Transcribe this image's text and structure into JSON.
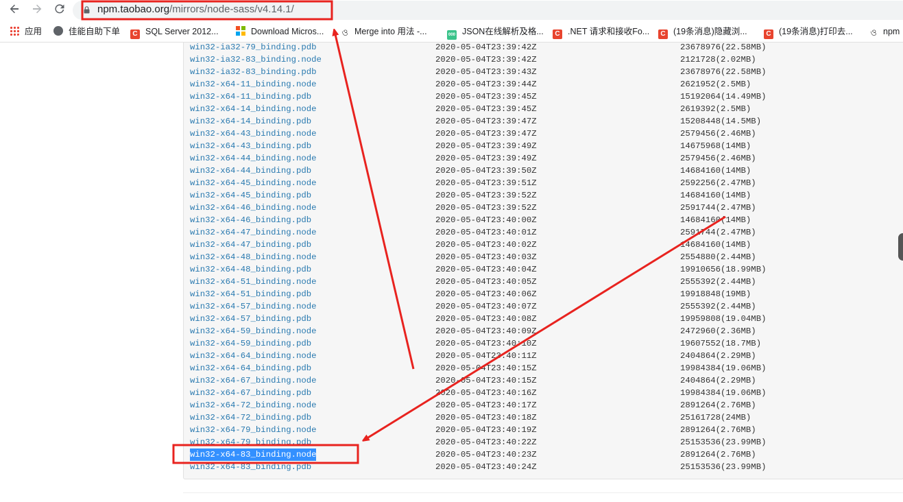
{
  "browser": {
    "back_icon": "back-arrow-icon",
    "forward_icon": "forward-arrow-icon",
    "reload_icon": "reload-icon",
    "url_host": "npm.taobao.org",
    "url_path": "/mirrors/node-sass/v4.14.1/"
  },
  "bookmarks": [
    {
      "label": "应用",
      "icon": "apps-grid-icon"
    },
    {
      "label": "佳能自助下单",
      "icon": "globe-icon"
    },
    {
      "label": "SQL Server 2012...",
      "icon": "csdn-icon"
    },
    {
      "label": "Download Micros...",
      "icon": "microsoft-icon"
    },
    {
      "label": "Merge into 用法 -...",
      "icon": "curl-icon"
    },
    {
      "label": "JSON在线解析及格...",
      "icon": "json-icon"
    },
    {
      "label": ".NET 请求和接收Fo...",
      "icon": "csdn-icon"
    },
    {
      "label": "(19条消息)隐藏浏...",
      "icon": "csdn-icon"
    },
    {
      "label": "(19条消息)打印去...",
      "icon": "csdn-icon"
    },
    {
      "label": "npm",
      "icon": "curl-icon"
    }
  ],
  "files": [
    {
      "name": "win32-ia32-79_binding.pdb",
      "date": "2020-05-04T23:39:42Z",
      "size": "23678976(22.58MB)"
    },
    {
      "name": "win32-ia32-83_binding.node",
      "date": "2020-05-04T23:39:42Z",
      "size": "2121728(2.02MB)"
    },
    {
      "name": "win32-ia32-83_binding.pdb",
      "date": "2020-05-04T23:39:43Z",
      "size": "23678976(22.58MB)"
    },
    {
      "name": "win32-x64-11_binding.node",
      "date": "2020-05-04T23:39:44Z",
      "size": "2621952(2.5MB)"
    },
    {
      "name": "win32-x64-11_binding.pdb",
      "date": "2020-05-04T23:39:45Z",
      "size": "15192064(14.49MB)"
    },
    {
      "name": "win32-x64-14_binding.node",
      "date": "2020-05-04T23:39:45Z",
      "size": "2619392(2.5MB)"
    },
    {
      "name": "win32-x64-14_binding.pdb",
      "date": "2020-05-04T23:39:47Z",
      "size": "15208448(14.5MB)"
    },
    {
      "name": "win32-x64-43_binding.node",
      "date": "2020-05-04T23:39:47Z",
      "size": "2579456(2.46MB)"
    },
    {
      "name": "win32-x64-43_binding.pdb",
      "date": "2020-05-04T23:39:49Z",
      "size": "14675968(14MB)"
    },
    {
      "name": "win32-x64-44_binding.node",
      "date": "2020-05-04T23:39:49Z",
      "size": "2579456(2.46MB)"
    },
    {
      "name": "win32-x64-44_binding.pdb",
      "date": "2020-05-04T23:39:50Z",
      "size": "14684160(14MB)"
    },
    {
      "name": "win32-x64-45_binding.node",
      "date": "2020-05-04T23:39:51Z",
      "size": "2592256(2.47MB)"
    },
    {
      "name": "win32-x64-45_binding.pdb",
      "date": "2020-05-04T23:39:52Z",
      "size": "14684160(14MB)"
    },
    {
      "name": "win32-x64-46_binding.node",
      "date": "2020-05-04T23:39:52Z",
      "size": "2591744(2.47MB)"
    },
    {
      "name": "win32-x64-46_binding.pdb",
      "date": "2020-05-04T23:40:00Z",
      "size": "14684160(14MB)"
    },
    {
      "name": "win32-x64-47_binding.node",
      "date": "2020-05-04T23:40:01Z",
      "size": "2591744(2.47MB)"
    },
    {
      "name": "win32-x64-47_binding.pdb",
      "date": "2020-05-04T23:40:02Z",
      "size": "14684160(14MB)"
    },
    {
      "name": "win32-x64-48_binding.node",
      "date": "2020-05-04T23:40:03Z",
      "size": "2554880(2.44MB)"
    },
    {
      "name": "win32-x64-48_binding.pdb",
      "date": "2020-05-04T23:40:04Z",
      "size": "19910656(18.99MB)"
    },
    {
      "name": "win32-x64-51_binding.node",
      "date": "2020-05-04T23:40:05Z",
      "size": "2555392(2.44MB)"
    },
    {
      "name": "win32-x64-51_binding.pdb",
      "date": "2020-05-04T23:40:06Z",
      "size": "19918848(19MB)"
    },
    {
      "name": "win32-x64-57_binding.node",
      "date": "2020-05-04T23:40:07Z",
      "size": "2555392(2.44MB)"
    },
    {
      "name": "win32-x64-57_binding.pdb",
      "date": "2020-05-04T23:40:08Z",
      "size": "19959808(19.04MB)"
    },
    {
      "name": "win32-x64-59_binding.node",
      "date": "2020-05-04T23:40:09Z",
      "size": "2472960(2.36MB)"
    },
    {
      "name": "win32-x64-59_binding.pdb",
      "date": "2020-05-04T23:40:10Z",
      "size": "19607552(18.7MB)"
    },
    {
      "name": "win32-x64-64_binding.node",
      "date": "2020-05-04T23:40:11Z",
      "size": "2404864(2.29MB)"
    },
    {
      "name": "win32-x64-64_binding.pdb",
      "date": "2020-05-04T23:40:15Z",
      "size": "19984384(19.06MB)"
    },
    {
      "name": "win32-x64-67_binding.node",
      "date": "2020-05-04T23:40:15Z",
      "size": "2404864(2.29MB)"
    },
    {
      "name": "win32-x64-67_binding.pdb",
      "date": "2020-05-04T23:40:16Z",
      "size": "19984384(19.06MB)"
    },
    {
      "name": "win32-x64-72_binding.node",
      "date": "2020-05-04T23:40:17Z",
      "size": "2891264(2.76MB)"
    },
    {
      "name": "win32-x64-72_binding.pdb",
      "date": "2020-05-04T23:40:18Z",
      "size": "25161728(24MB)"
    },
    {
      "name": "win32-x64-79_binding.node",
      "date": "2020-05-04T23:40:19Z",
      "size": "2891264(2.76MB)"
    },
    {
      "name": "win32-x64-79_binding.pdb",
      "date": "2020-05-04T23:40:22Z",
      "size": "25153536(23.99MB)"
    },
    {
      "name": "win32-x64-83_binding.node",
      "date": "2020-05-04T23:40:23Z",
      "size": "2891264(2.76MB)",
      "selected": true
    },
    {
      "name": "win32-x64-83_binding.pdb",
      "date": "2020-05-04T23:40:24Z",
      "size": "25153536(23.99MB)"
    }
  ],
  "annotation": {
    "color": "#e8231f",
    "highlight_color": "#3390ff"
  }
}
